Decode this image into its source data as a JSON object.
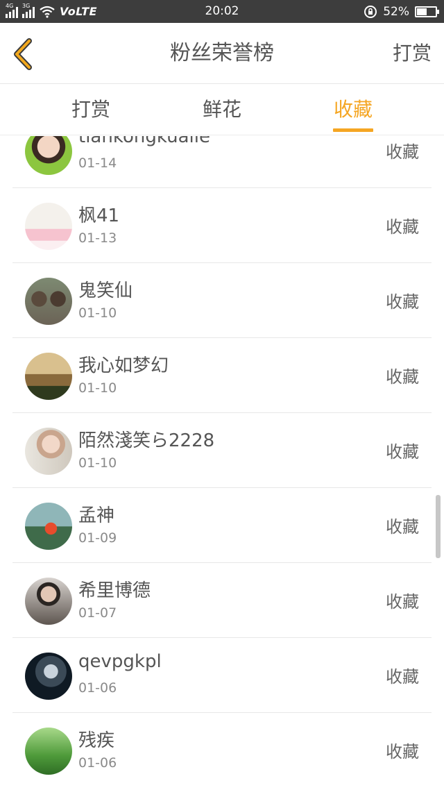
{
  "status_bar": {
    "network_left": "4G",
    "network_right": "3G",
    "volte": "VoLTE",
    "time": "20:02",
    "battery_text": "52%",
    "battery_level": 0.52
  },
  "header": {
    "title": "粉丝荣誉榜",
    "action": "打赏",
    "back_icon": "chevron-left-icon",
    "back_color": "#f2a81d"
  },
  "tabs": [
    {
      "label": "打赏",
      "active": false
    },
    {
      "label": "鲜花",
      "active": false
    },
    {
      "label": "收藏",
      "active": true
    }
  ],
  "accent_color": "#f5a623",
  "list": [
    {
      "name": "tiankongkuaile",
      "date": "01-14",
      "action": "收藏",
      "avatar": "avatar-photo-child"
    },
    {
      "name": "枫41",
      "date": "01-13",
      "action": "收藏",
      "avatar": "avatar-photo-girl-white"
    },
    {
      "name": "鬼笑仙",
      "date": "01-10",
      "action": "收藏",
      "avatar": "avatar-photo-two-kids"
    },
    {
      "name": "我心如梦幻",
      "date": "01-10",
      "action": "收藏",
      "avatar": "avatar-photo-sunset"
    },
    {
      "name": "陌然淺笑ら2228",
      "date": "01-10",
      "action": "收藏",
      "avatar": "avatar-photo-woman"
    },
    {
      "name": "孟神",
      "date": "01-09",
      "action": "收藏",
      "avatar": "avatar-photo-paper-crane"
    },
    {
      "name": "希里博德",
      "date": "01-07",
      "action": "收藏",
      "avatar": "avatar-photo-tattoo-man"
    },
    {
      "name": "qevpgkpl",
      "date": "01-06",
      "action": "收藏",
      "avatar": "avatar-photo-dark-figure"
    },
    {
      "name": "残疾",
      "date": "01-06",
      "action": "收藏",
      "avatar": "avatar-photo-forest"
    }
  ]
}
